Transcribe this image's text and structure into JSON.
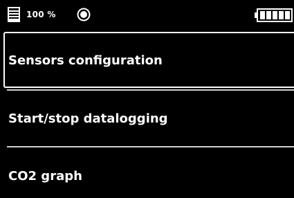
{
  "status_bar": {
    "storage_icon": "storage-card-icon",
    "storage_percent": "100 %",
    "record_icon": "record-icon",
    "battery_icon": "battery-full-icon",
    "battery_level": 1.0
  },
  "menu": {
    "items": [
      {
        "label": "Sensors configuration",
        "selected": true
      },
      {
        "label": "Start/stop datalogging",
        "selected": false
      },
      {
        "label": "CO2 graph",
        "selected": false
      }
    ]
  },
  "colors": {
    "background": "#000000",
    "foreground": "#ffffff",
    "separator": "#cfcfcf"
  }
}
